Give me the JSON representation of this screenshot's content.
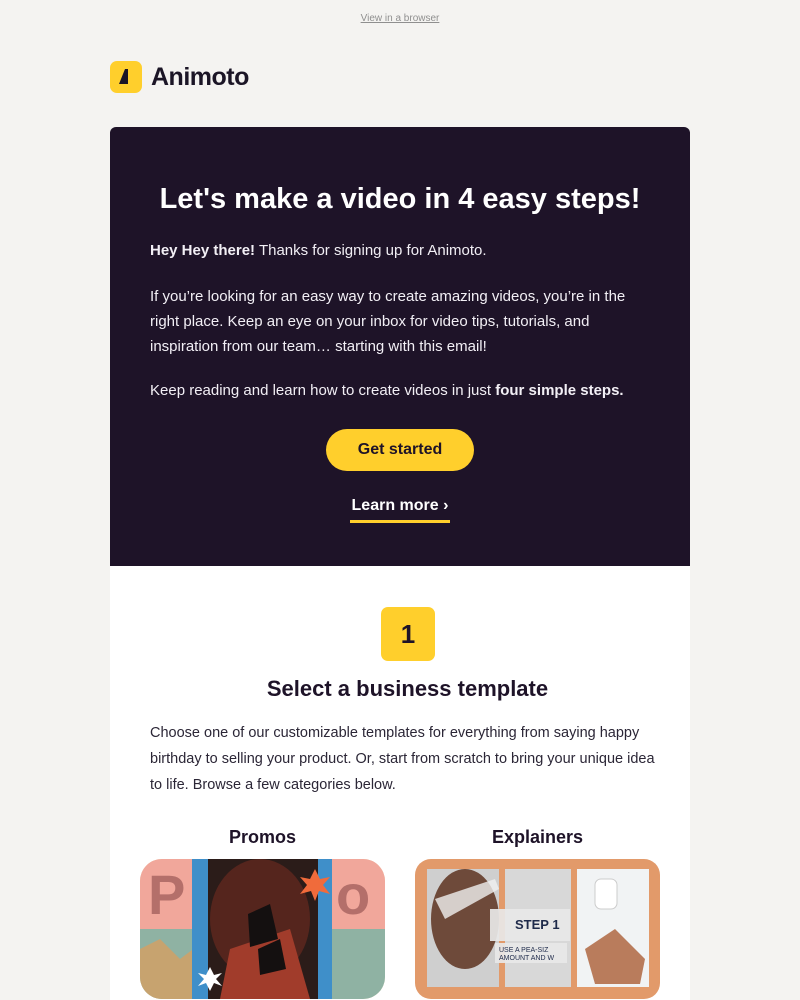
{
  "header": {
    "view_browser": "View in a browser"
  },
  "logo": {
    "text": "Animoto"
  },
  "hero": {
    "title": "Let's make a video in 4 easy steps!",
    "greeting_bold": "Hey Hey there!",
    "greeting_rest": " Thanks for signing up for Animoto.",
    "paragraph": "If you’re looking for an easy way to create amazing videos, you’re in the right place. Keep an eye on your inbox for video tips, tutorials, and inspiration from our team… starting with this email!",
    "keep_reading": "Keep reading and learn how to create videos in just ",
    "keep_reading_bold": "four simple steps.",
    "cta_label": "Get started",
    "learn_more": "Learn more ›"
  },
  "step1": {
    "number": "1",
    "title": "Select a business template",
    "body": "Choose one of our customizable templates for everything from saying happy birthday to selling your product. Or, start from scratch to bring your unique idea to life. Browse a few categories below.",
    "categories": [
      {
        "label": "Promos"
      },
      {
        "label": "Explainers"
      }
    ],
    "explainer_overlay_title": "STEP 1",
    "explainer_overlay_text": "USE A PEA-SIZ AMOUNT AND W UP BEFORE APPLY"
  },
  "colors": {
    "accent": "#ffcf2c",
    "hero_bg": "#1e1328",
    "page_bg": "#f4f3f1"
  }
}
